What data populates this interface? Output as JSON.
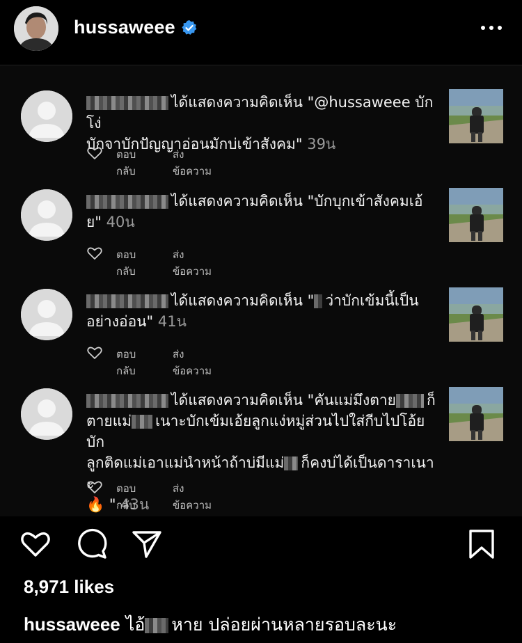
{
  "header": {
    "username": "hussaweee",
    "verified_icon": "verified-badge-icon",
    "more_icon": "more-horizontal-icon",
    "accent": "#3897f0"
  },
  "notifications": [
    {
      "action": "ได้แสดงความคิดเห็น",
      "comment_line1": "\"@hussaweee บักโง่",
      "comment_rest": "บักจาบักปัญญาอ่อนมักบ่เข้าสังคม\"",
      "time": "39น",
      "reply_label": "ตอบกลับ",
      "send_label": "ส่งข้อความ"
    },
    {
      "action": "ได้แสดงความคิดเห็น",
      "comment_line1": "\"บักบุกเข้าสังคมเอ้",
      "comment_rest": "ย\"",
      "time": "40น",
      "reply_label": "ตอบกลับ",
      "send_label": "ส่งข้อความ"
    },
    {
      "action": "ได้แสดงความคิดเห็น",
      "comment_line1": "\"",
      "comment_line1b": "ว่าบักเข้มนี้เป็น",
      "comment_rest": "อย่างอ่อน\"",
      "time": "41น",
      "reply_label": "ตอบกลับ",
      "send_label": "ส่งข้อความ"
    },
    {
      "action": "ได้แสดงความคิดเห็น",
      "comment_line1": "\"คันแม่มึงตาย",
      "comment_line1b": "ก็",
      "comment_line2a": "ตายแม่",
      "comment_line2b": "เนาะบักเข้มเอ้ยลูกแง่หมู่ส่วนไปใส่กีบไปโอ้ยบัก",
      "comment_line3a": "ลูกติดแม่เอาแม่นำหน้าถ้าบ่มีแม่",
      "comment_line3b": "ก็คงบ่ได้เป็นดาราเนาะ",
      "comment_line4": "🔥 \"",
      "time": "43น",
      "reply_label": "ตอบกลับ",
      "send_label": "ส่งข้อความ"
    }
  ],
  "actions": {
    "like_icon": "heart-icon",
    "comment_icon": "comment-icon",
    "share_icon": "send-icon",
    "save_icon": "bookmark-icon"
  },
  "likes": "8,971 likes",
  "caption": {
    "username": "hussaweee",
    "text_a": "ไอ้",
    "text_b": "หาย ปล่อยผ่านหลายรอบละนะ"
  }
}
